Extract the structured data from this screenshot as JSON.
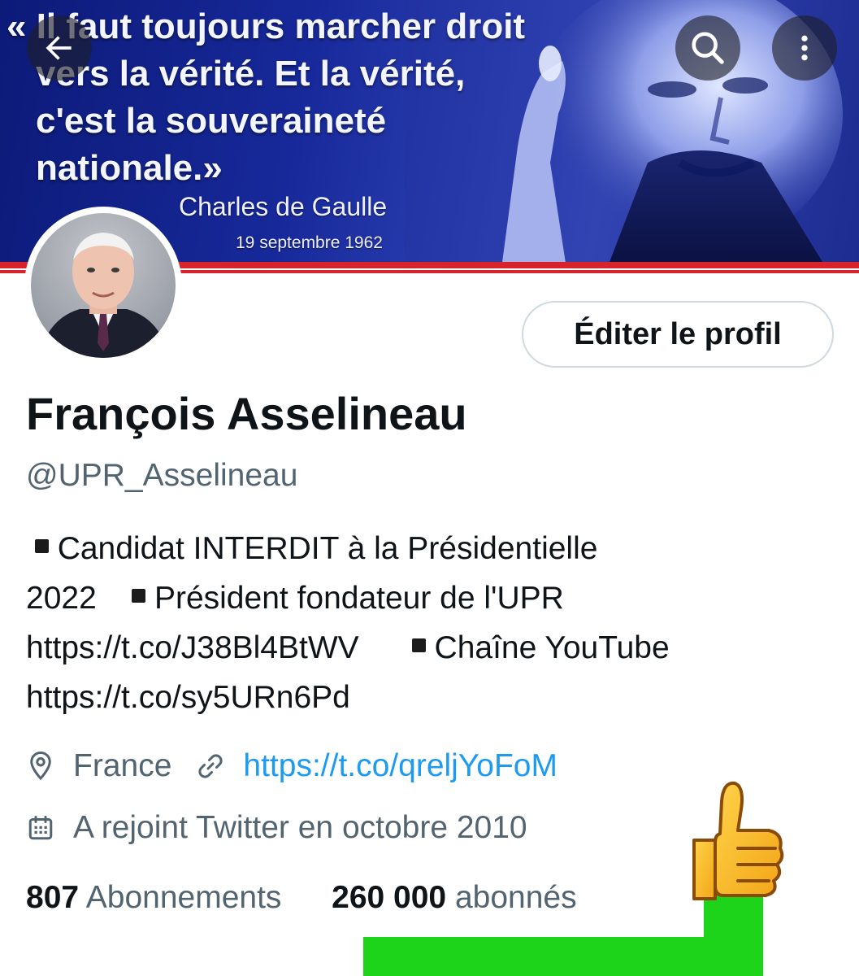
{
  "banner": {
    "quote_lines": [
      "« Il faut toujours marcher droit",
      "vers la vérité. Et la vérité,",
      "c'est la souveraineté",
      "nationale.»"
    ],
    "author": "Charles de Gaulle",
    "date": "19 septembre 1962",
    "stripe_color": "#d8232a"
  },
  "toolbar": {
    "back_icon": "arrow-left-icon",
    "search_icon": "search-icon",
    "more_icon": "more-vertical-icon"
  },
  "profile": {
    "edit_label": "Éditer le profil",
    "display_name": "François Asselineau",
    "handle": "@UPR_Asselineau",
    "bio_lines": [
      [
        "Candidat INTERDIT à la Présidentielle"
      ],
      [
        "2022",
        "Président fondateur de l'UPR"
      ],
      [
        "https://t.co/J38Bl4BtWV",
        "Chaîne YouTube"
      ],
      [
        "https://t.co/sy5URn6Pd"
      ]
    ],
    "location": "France",
    "website": "https://t.co/qreljYoFoM",
    "joined": "A rejoint Twitter en octobre 2010",
    "following_count": "807",
    "following_label": "Abonnements",
    "followers_count": "260 000",
    "followers_label": "abonnés",
    "link_color": "#1d9bf0"
  },
  "overlay": {
    "emoji_icon": "thumbs-up-icon",
    "highlight_color": "#1ed41b"
  }
}
